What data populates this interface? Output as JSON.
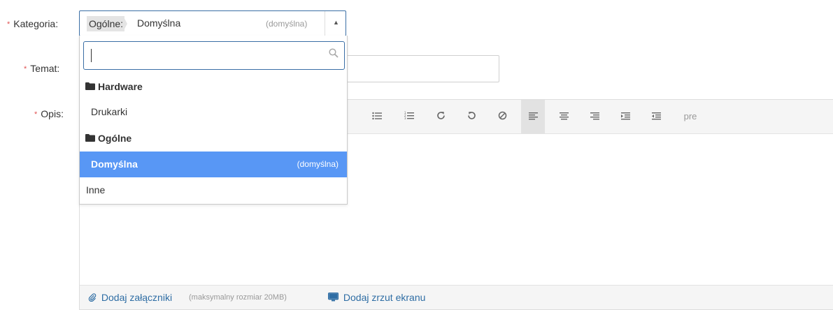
{
  "form": {
    "required_mark": "*",
    "category_label": "Kategoria:",
    "subject_label": "Temat:",
    "description_label": "Opis:"
  },
  "category_select": {
    "parent_crumb": "Ogólne:",
    "value": "Domyślna",
    "default_note": "(domyślna)",
    "arrow_icon": "triangle-up-icon"
  },
  "dropdown": {
    "search_value": "",
    "search_icon": "search-icon",
    "groups": [
      {
        "label": "Hardware",
        "icon": "folder-icon",
        "items": [
          {
            "label": "Drukarki"
          }
        ]
      },
      {
        "label": "Ogólne",
        "icon": "folder-icon",
        "items": [
          {
            "label": "Domyślna",
            "note": "(domyślna)",
            "selected": true
          },
          {
            "label": "Inne"
          }
        ]
      }
    ],
    "selected_color": "#5897f5"
  },
  "toolbar": {
    "buttons": [
      {
        "name": "unordered-list",
        "icon": "list-ul-icon",
        "glyph": "☰"
      },
      {
        "name": "ordered-list",
        "icon": "list-ol-icon",
        "glyph": "☷"
      },
      {
        "name": "redo",
        "icon": "redo-icon",
        "glyph": "↻"
      },
      {
        "name": "undo",
        "icon": "undo-icon",
        "glyph": "↺"
      },
      {
        "name": "clear-format",
        "icon": "ban-icon",
        "glyph": "⊘"
      },
      {
        "name": "align-left",
        "icon": "align-left-icon",
        "glyph": "≡",
        "active": true
      },
      {
        "name": "align-center",
        "icon": "align-center-icon",
        "glyph": "≡"
      },
      {
        "name": "align-right",
        "icon": "align-right-icon",
        "glyph": "≡"
      },
      {
        "name": "indent",
        "icon": "indent-icon",
        "glyph": "⇥"
      },
      {
        "name": "outdent",
        "icon": "outdent-icon",
        "glyph": "⇤"
      }
    ],
    "pre_label": "pre"
  },
  "attachments": {
    "add_attachments": "Dodaj załączniki",
    "max_size_hint": "(maksymalny rozmiar 20MB)",
    "add_screenshot": "Dodaj zrzut ekranu",
    "paperclip_icon": "paperclip-icon",
    "monitor_icon": "monitor-icon",
    "link_color": "#2e6da4"
  },
  "colors": {
    "focus_border": "#3a6ea5",
    "required_star": "#e05252"
  }
}
